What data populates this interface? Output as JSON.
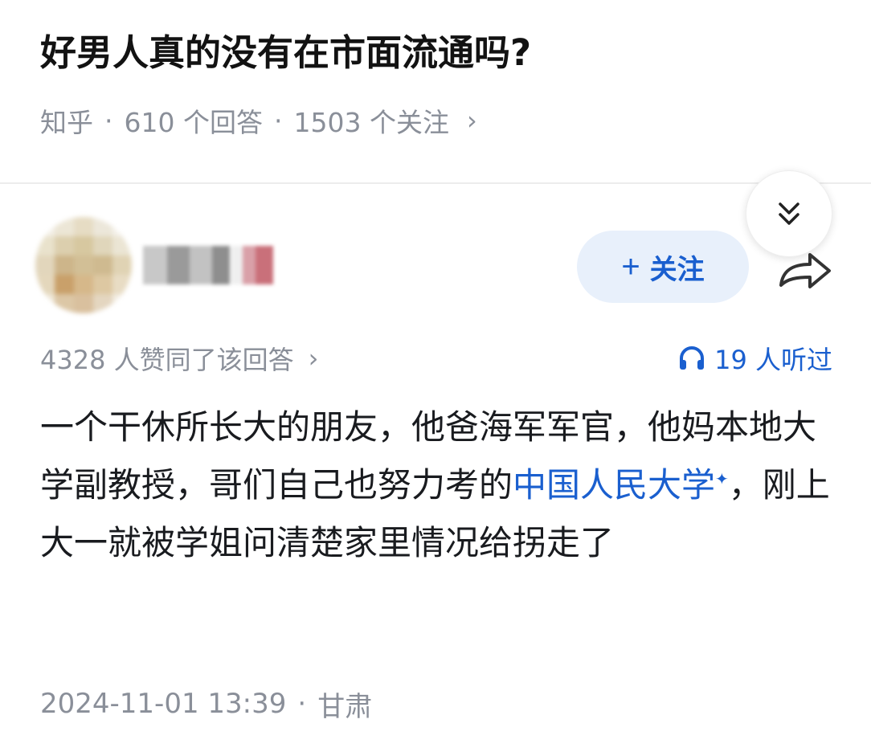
{
  "question": {
    "title": "好男人真的没有在市面流通吗?",
    "source": "知乎",
    "separator": "·",
    "answers_count": "610 个回答",
    "followers_count": "1503 个关注",
    "chevron": "›"
  },
  "author": {
    "follow_plus": "+",
    "follow_label": "关注"
  },
  "stats": {
    "upvotes": "4328 人赞同了该回答",
    "upvotes_chevron": "›",
    "listens": "19 人听过"
  },
  "answer": {
    "text_before_link": "一个干休所长大的朋友，他爸海军军官，他妈本地大学副教授，哥们自己也努力考的",
    "link_text": "中国人民大学",
    "link_marker": "✦",
    "text_after_link": "，刚上大一就被学姐问清楚家里情况给拐走了"
  },
  "footer": {
    "datetime": "2024-11-01 13:39",
    "separator": "·",
    "location": "甘肃"
  },
  "icons": {
    "collapse": "double-chevron-down-icon",
    "share": "share-arrow-icon",
    "listen": "headphones-icon"
  },
  "colors": {
    "accent_blue": "#1a5fcf",
    "follow_bg": "#e8f0fb",
    "meta_gray": "#8a8f99",
    "title_black": "#121212"
  }
}
